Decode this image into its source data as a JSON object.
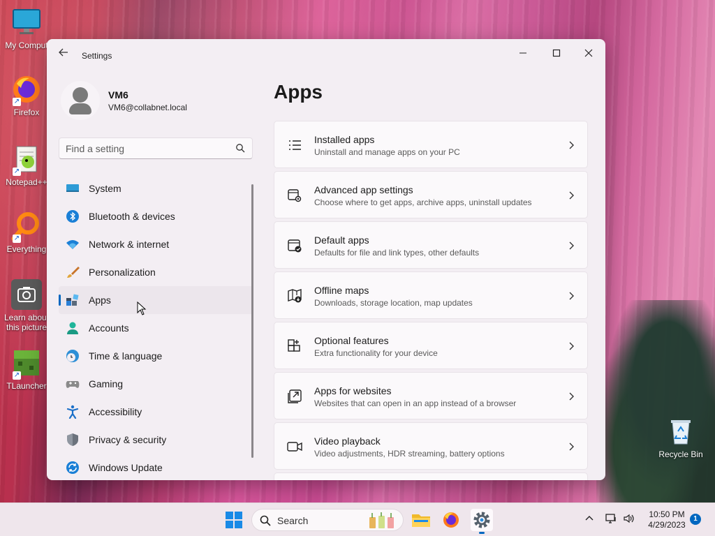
{
  "desktop": {
    "icons": [
      {
        "label": "My Comput",
        "icon": "monitor-icon"
      },
      {
        "label": "Firefox",
        "icon": "firefox-icon"
      },
      {
        "label": "Notepad++",
        "icon": "notepadpp-icon"
      },
      {
        "label": "Everything",
        "icon": "everything-icon"
      },
      {
        "label": "Learn about this picture",
        "icon": "camera-icon"
      },
      {
        "label": "TLauncher",
        "icon": "tlauncher-icon"
      },
      {
        "label": "Recycle Bin",
        "icon": "recycle-bin-icon"
      }
    ]
  },
  "window": {
    "title": "Settings",
    "back_icon": "back-arrow-icon",
    "controls": {
      "minimize": "—",
      "maximize": "☐",
      "close": "✕"
    }
  },
  "profile": {
    "name": "VM6",
    "email": "VM6@collabnet.local"
  },
  "search": {
    "placeholder": "Find a setting"
  },
  "nav": {
    "items": [
      {
        "label": "System",
        "icon": "system-icon"
      },
      {
        "label": "Bluetooth & devices",
        "icon": "bluetooth-icon"
      },
      {
        "label": "Network & internet",
        "icon": "wifi-icon"
      },
      {
        "label": "Personalization",
        "icon": "brush-icon"
      },
      {
        "label": "Apps",
        "icon": "apps-icon",
        "active": true
      },
      {
        "label": "Accounts",
        "icon": "accounts-icon"
      },
      {
        "label": "Time & language",
        "icon": "time-language-icon"
      },
      {
        "label": "Gaming",
        "icon": "gamepad-icon"
      },
      {
        "label": "Accessibility",
        "icon": "accessibility-icon"
      },
      {
        "label": "Privacy & security",
        "icon": "shield-icon"
      },
      {
        "label": "Windows Update",
        "icon": "update-icon"
      }
    ]
  },
  "main": {
    "title": "Apps",
    "cards": [
      {
        "title": "Installed apps",
        "subtitle": "Uninstall and manage apps on your PC",
        "icon": "list-icon"
      },
      {
        "title": "Advanced app settings",
        "subtitle": "Choose where to get apps, archive apps, uninstall updates",
        "icon": "app-gear-icon"
      },
      {
        "title": "Default apps",
        "subtitle": "Defaults for file and link types, other defaults",
        "icon": "default-apps-icon"
      },
      {
        "title": "Offline maps",
        "subtitle": "Downloads, storage location, map updates",
        "icon": "map-icon"
      },
      {
        "title": "Optional features",
        "subtitle": "Extra functionality for your device",
        "icon": "add-grid-icon"
      },
      {
        "title": "Apps for websites",
        "subtitle": "Websites that can open in an app instead of a browser",
        "icon": "open-external-icon"
      },
      {
        "title": "Video playback",
        "subtitle": "Video adjustments, HDR streaming, battery options",
        "icon": "video-icon"
      }
    ]
  },
  "taskbar": {
    "search_label": "Search",
    "time": "10:50 PM",
    "date": "4/29/2023",
    "notification_count": "1",
    "accent": "#0067c0"
  }
}
